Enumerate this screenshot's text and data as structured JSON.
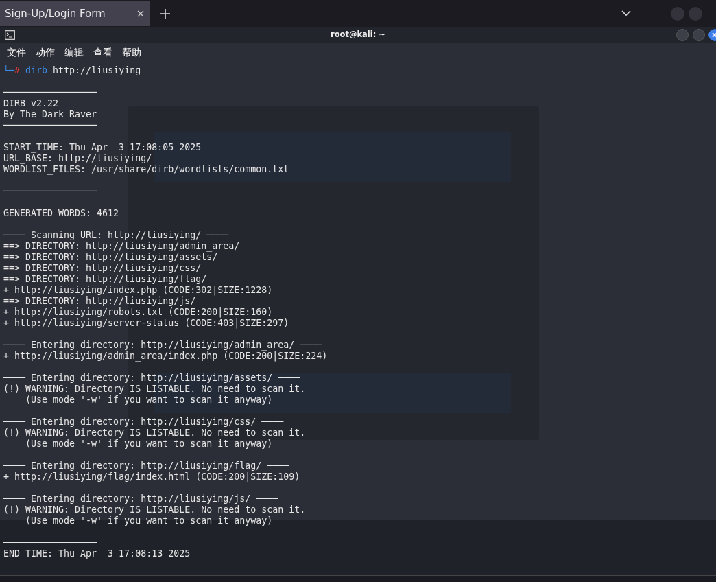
{
  "browser": {
    "tabs": [
      {
        "title": "Sign-Up/Login Form",
        "selected": true
      }
    ]
  },
  "terminal": {
    "title": "root@kali: ~",
    "menu": [
      "文件",
      "动作",
      "编辑",
      "查看",
      "帮助"
    ],
    "prompt": {
      "corner": "└─",
      "symbol": "#",
      "command": "dirb",
      "args": "http://liusiying"
    },
    "lines": [
      {
        "kind": "blank"
      },
      {
        "kind": "text",
        "text": "─────────────────"
      },
      {
        "kind": "text",
        "text": "DIRB v2.22"
      },
      {
        "kind": "text",
        "text": "By The Dark Raver"
      },
      {
        "kind": "text",
        "text": "─────────────────"
      },
      {
        "kind": "blank"
      },
      {
        "kind": "text",
        "text": "START_TIME: Thu Apr  3 17:08:05 2025"
      },
      {
        "kind": "text",
        "text": "URL_BASE: http://liusiying/"
      },
      {
        "kind": "text",
        "text": "WORDLIST_FILES: /usr/share/dirb/wordlists/common.txt"
      },
      {
        "kind": "blank"
      },
      {
        "kind": "text",
        "text": "─────────────────"
      },
      {
        "kind": "blank"
      },
      {
        "kind": "text",
        "text": "GENERATED WORDS: 4612"
      },
      {
        "kind": "blank"
      },
      {
        "kind": "text",
        "text": "──── Scanning URL: http://liusiying/ ────"
      },
      {
        "kind": "text",
        "text": "==> DIRECTORY: http://liusiying/admin_area/"
      },
      {
        "kind": "text",
        "text": "==> DIRECTORY: http://liusiying/assets/"
      },
      {
        "kind": "text",
        "text": "==> DIRECTORY: http://liusiying/css/"
      },
      {
        "kind": "text",
        "text": "==> DIRECTORY: http://liusiying/flag/"
      },
      {
        "kind": "text",
        "text": "+ http://liusiying/index.php (CODE:302|SIZE:1228)"
      },
      {
        "kind": "text",
        "text": "==> DIRECTORY: http://liusiying/js/"
      },
      {
        "kind": "text",
        "text": "+ http://liusiying/robots.txt (CODE:200|SIZE:160)"
      },
      {
        "kind": "text",
        "text": "+ http://liusiying/server-status (CODE:403|SIZE:297)"
      },
      {
        "kind": "blank"
      },
      {
        "kind": "text",
        "text": "──── Entering directory: http://liusiying/admin_area/ ────"
      },
      {
        "kind": "text",
        "text": "+ http://liusiying/admin_area/index.php (CODE:200|SIZE:224)"
      },
      {
        "kind": "blank"
      },
      {
        "kind": "text",
        "text": "──── Entering directory: http://liusiying/assets/ ────"
      },
      {
        "kind": "text",
        "text": "(!) WARNING: Directory IS LISTABLE. No need to scan it."
      },
      {
        "kind": "text",
        "text": "    (Use mode '-w' if you want to scan it anyway)"
      },
      {
        "kind": "blank"
      },
      {
        "kind": "text",
        "text": "──── Entering directory: http://liusiying/css/ ────"
      },
      {
        "kind": "text",
        "text": "(!) WARNING: Directory IS LISTABLE. No need to scan it."
      },
      {
        "kind": "text",
        "text": "    (Use mode '-w' if you want to scan it anyway)"
      },
      {
        "kind": "blank"
      },
      {
        "kind": "text",
        "text": "──── Entering directory: http://liusiying/flag/ ────"
      },
      {
        "kind": "text",
        "text": "+ http://liusiying/flag/index.html (CODE:200|SIZE:109)"
      },
      {
        "kind": "blank"
      },
      {
        "kind": "text",
        "text": "──── Entering directory: http://liusiying/js/ ────"
      },
      {
        "kind": "text",
        "text": "(!) WARNING: Directory IS LISTABLE. No need to scan it."
      },
      {
        "kind": "text",
        "text": "    (Use mode '-w' if you want to scan it anyway)"
      },
      {
        "kind": "blank"
      },
      {
        "kind": "text",
        "text": "─────────────────"
      },
      {
        "kind": "text",
        "text": "END_TIME: Thu Apr  3 17:08:13 2025"
      }
    ]
  }
}
